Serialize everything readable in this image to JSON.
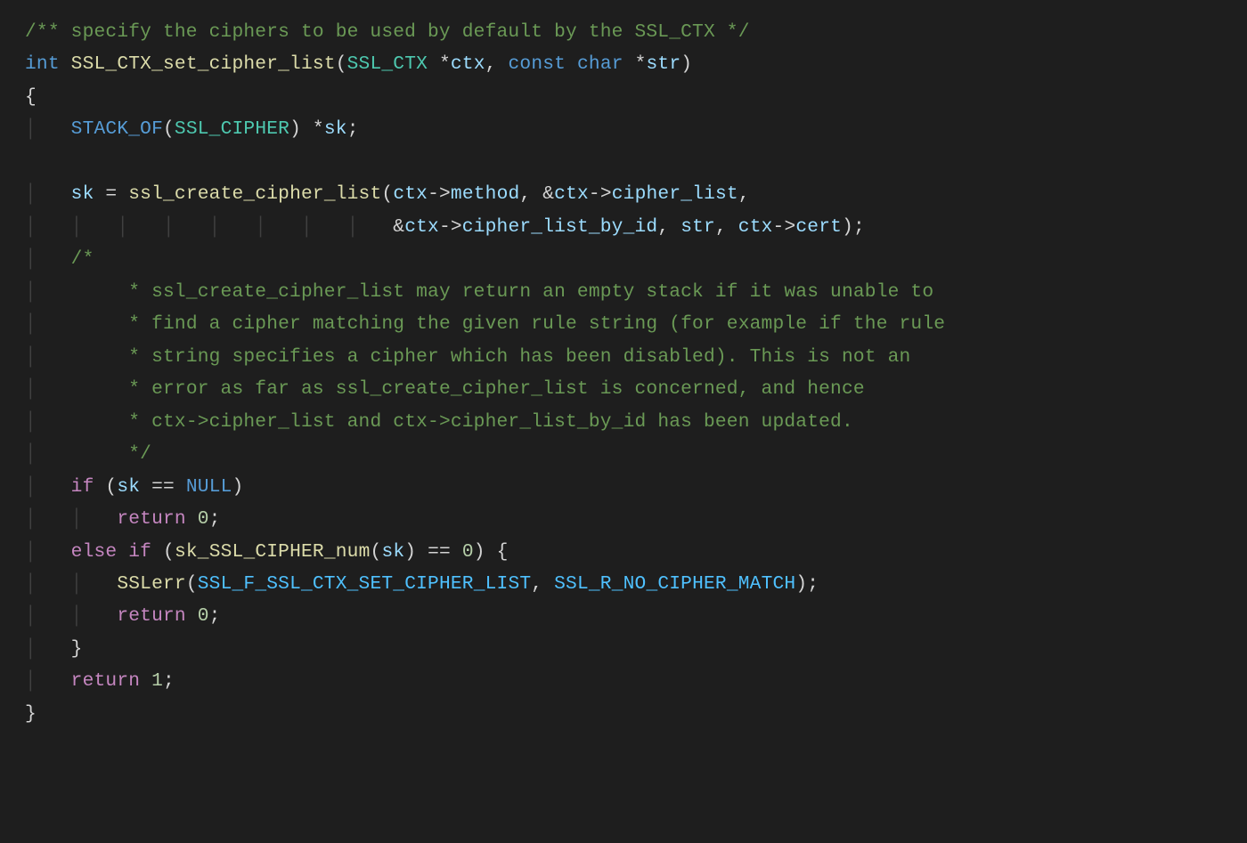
{
  "code": {
    "c_top": "/** specify the ciphers to be used by default by the SSL_CTX */",
    "kw_int": "int",
    "fn_name": "SSL_CTX_set_cipher_list",
    "p_open1": "(",
    "t_sslctx": "SSL_CTX",
    "star1": " *",
    "p_ctx": "ctx",
    "comma1": ", ",
    "kw_const": "const",
    "sp1": " ",
    "kw_char": "char",
    "star2": " *",
    "p_str": "str",
    "p_close1": ")",
    "brace_open": "{",
    "indent1": "    ",
    "m_stackof": "STACK_OF",
    "p_open2": "(",
    "t_sslcipher": "SSL_CIPHER",
    "p_close2": ")",
    "star3": " *",
    "v_sk": "sk",
    "semi1": ";",
    "assign_sk": "sk",
    "eq": " = ",
    "fn_create": "ssl_create_cipher_list",
    "p_open3": "(",
    "v_ctx1": "ctx",
    "arrow1": "->",
    "m_method": "method",
    "comma2": ", &",
    "v_ctx2": "ctx",
    "arrow2": "->",
    "m_cipherlist": "cipher_list",
    "comma3": ",",
    "cont_indent": "                                ",
    "amp2": "&",
    "v_ctx3": "ctx",
    "arrow3": "->",
    "m_cipherlistbyid": "cipher_list_by_id",
    "comma4": ", ",
    "v_str2": "str",
    "comma5": ", ",
    "v_ctx4": "ctx",
    "arrow4": "->",
    "m_cert": "cert",
    "p_close3": ");",
    "cblk_open": "/*",
    "cblk_l1": "     * ssl_create_cipher_list may return an empty stack if it was unable to",
    "cblk_l2": "     * find a cipher matching the given rule string (for example if the rule",
    "cblk_l3": "     * string specifies a cipher which has been disabled). This is not an",
    "cblk_l4": "     * error as far as ssl_create_cipher_list is concerned, and hence",
    "cblk_l5": "     * ctx->cipher_list and ctx->cipher_list_by_id has been updated.",
    "cblk_close": "     */",
    "kw_if": "if",
    "p_open4": " (",
    "v_sk2": "sk",
    "eqeq": " == ",
    "k_null": "NULL",
    "p_close4": ")",
    "kw_return1": "return",
    "sp_r1": " ",
    "n_zero1": "0",
    "semi2": ";",
    "kw_else": "else",
    "sp_e": " ",
    "kw_if2": "if",
    "p_open5": " (",
    "fn_sknum": "sk_SSL_CIPHER_num",
    "p_open6": "(",
    "v_sk3": "sk",
    "p_close6": ")",
    "eqeq2": " == ",
    "n_zero2": "0",
    "p_close5": ") {",
    "fn_sslerr": "SSLerr",
    "p_open7": "(",
    "c_fconst": "SSL_F_SSL_CTX_SET_CIPHER_LIST",
    "comma6": ", ",
    "c_rconst": "SSL_R_NO_CIPHER_MATCH",
    "p_close7": ");",
    "kw_return2": "return",
    "sp_r2": " ",
    "n_zero3": "0",
    "semi3": ";",
    "brace_close_inner": "}",
    "kw_return3": "return",
    "sp_r3": " ",
    "n_one": "1",
    "semi4": ";",
    "brace_close": "}"
  }
}
